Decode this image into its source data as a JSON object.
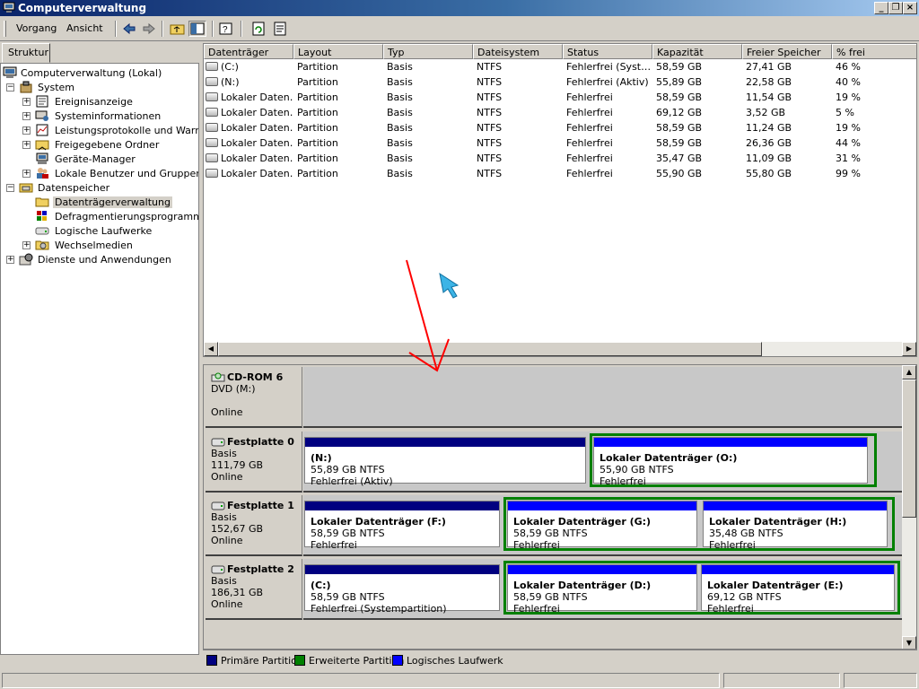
{
  "window": {
    "title": "Computerverwaltung"
  },
  "menu": {
    "action": "Vorgang",
    "view": "Ansicht"
  },
  "toolbar_icons": [
    "back-arrow-icon",
    "forward-arrow-icon",
    "up-folder-icon",
    "show-hide-tree-icon",
    "help-icon",
    "refresh-icon",
    "properties-icon"
  ],
  "sidebar": {
    "tab": "Struktur",
    "root": "Computerverwaltung (Lokal)",
    "system": "System",
    "system_items": [
      "Ereignisanzeige",
      "Systeminformationen",
      "Leistungsprotokolle und Warnungen",
      "Freigegebene Ordner",
      "Geräte-Manager",
      "Lokale Benutzer und Gruppen"
    ],
    "storage": "Datenspeicher",
    "storage_items": [
      "Datenträgerverwaltung",
      "Defragmentierungsprogramm",
      "Logische Laufwerke",
      "Wechselmedien"
    ],
    "services": "Dienste und Anwendungen"
  },
  "table": {
    "columns": [
      "Datenträger",
      "Layout",
      "Typ",
      "Dateisystem",
      "Status",
      "Kapazität",
      "Freier Speicher",
      "% frei"
    ],
    "rows": [
      [
        "(C:)",
        "Partition",
        "Basis",
        "NTFS",
        "Fehlerfrei (Syst…",
        "58,59 GB",
        "27,41 GB",
        "46 %"
      ],
      [
        "(N:)",
        "Partition",
        "Basis",
        "NTFS",
        "Fehlerfrei (Aktiv)",
        "55,89 GB",
        "22,58 GB",
        "40 %"
      ],
      [
        "Lokaler Daten…",
        "Partition",
        "Basis",
        "NTFS",
        "Fehlerfrei",
        "58,59 GB",
        "11,54 GB",
        "19 %"
      ],
      [
        "Lokaler Daten…",
        "Partition",
        "Basis",
        "NTFS",
        "Fehlerfrei",
        "69,12 GB",
        "3,52 GB",
        "5 %"
      ],
      [
        "Lokaler Daten…",
        "Partition",
        "Basis",
        "NTFS",
        "Fehlerfrei",
        "58,59 GB",
        "11,24 GB",
        "19 %"
      ],
      [
        "Lokaler Daten…",
        "Partition",
        "Basis",
        "NTFS",
        "Fehlerfrei",
        "58,59 GB",
        "26,36 GB",
        "44 %"
      ],
      [
        "Lokaler Daten…",
        "Partition",
        "Basis",
        "NTFS",
        "Fehlerfrei",
        "35,47 GB",
        "11,09 GB",
        "31 %"
      ],
      [
        "Lokaler Daten…",
        "Partition",
        "Basis",
        "NTFS",
        "Fehlerfrei",
        "55,90 GB",
        "55,80 GB",
        "99 %"
      ]
    ]
  },
  "disks": [
    {
      "name": "CD-ROM 6",
      "lines": [
        "DVD (M:)",
        "",
        "Online"
      ],
      "partitions": []
    },
    {
      "name": "Festplatte 0",
      "lines": [
        "Basis",
        "111,79 GB",
        "Online"
      ],
      "partitions": [
        {
          "name": "(N:)",
          "size": "55,89 GB NTFS",
          "status": "Fehlerfrei (Aktiv)",
          "kind": "primary"
        },
        {
          "name": "Lokaler Datenträger  (O:)",
          "size": "55,90 GB NTFS",
          "status": "Fehlerfrei",
          "kind": "logical"
        }
      ]
    },
    {
      "name": "Festplatte 1",
      "lines": [
        "Basis",
        "152,67 GB",
        "Online"
      ],
      "partitions": [
        {
          "name": "Lokaler Datenträger  (F:)",
          "size": "58,59 GB NTFS",
          "status": "Fehlerfrei",
          "kind": "primary"
        },
        {
          "name": "Lokaler Datenträger  (G:)",
          "size": "58,59 GB NTFS",
          "status": "Fehlerfrei",
          "kind": "logical"
        },
        {
          "name": "Lokaler Datenträger  (H:)",
          "size": "35,48 GB NTFS",
          "status": "Fehlerfrei",
          "kind": "logical"
        }
      ]
    },
    {
      "name": "Festplatte 2",
      "lines": [
        "Basis",
        "186,31 GB",
        "Online"
      ],
      "partitions": [
        {
          "name": "(C:)",
          "size": "58,59 GB NTFS",
          "status": "Fehlerfrei (Systempartition)",
          "kind": "primary"
        },
        {
          "name": "Lokaler Datenträger  (D:)",
          "size": "58,59 GB NTFS",
          "status": "Fehlerfrei",
          "kind": "logical"
        },
        {
          "name": "Lokaler Datenträger  (E:)",
          "size": "69,12 GB NTFS",
          "status": "Fehlerfrei",
          "kind": "logical"
        }
      ]
    }
  ],
  "legend": {
    "primary": "Primäre Partition",
    "extended": "Erweiterte Partition",
    "logical": "Logisches Laufwerk"
  },
  "colors": {
    "primary": "#000080",
    "extended": "#008000",
    "logical": "#0000ff",
    "annotation": "#ff0000",
    "cursor": "#3cb4e6"
  }
}
